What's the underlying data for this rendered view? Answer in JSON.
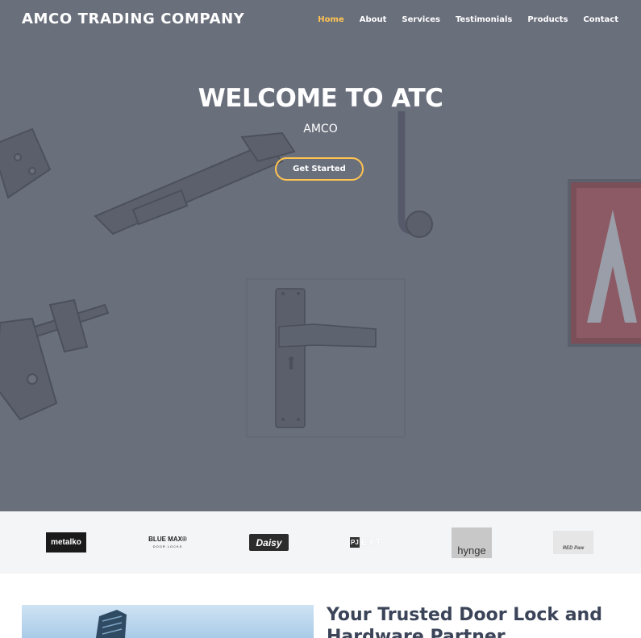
{
  "header": {
    "logo": "AMCO TRADING COMPANY",
    "nav": [
      "Home",
      "About",
      "Services",
      "Testimonials",
      "Products",
      "Contact"
    ],
    "active_nav": "Home"
  },
  "hero": {
    "title": "WELCOME TO ATC",
    "subtitle": "AMCO",
    "cta_label": "Get Started"
  },
  "brands": {
    "metalko": "metalko",
    "bluemax": "BLUE MAX®",
    "bluemax_sub": "DOOR LOCKS",
    "daisy": "Daisy",
    "pjext_pj": "PJ",
    "pjext_ext": "EXT",
    "hynge": "hynge",
    "redpaw": "RED Paw"
  },
  "about": {
    "title": "Your Trusted Door Lock and Hardware Partner"
  },
  "colors": {
    "accent": "#ffc451",
    "hero_overlay": "#6a6f7c",
    "heading_dark": "#3b4458"
  }
}
